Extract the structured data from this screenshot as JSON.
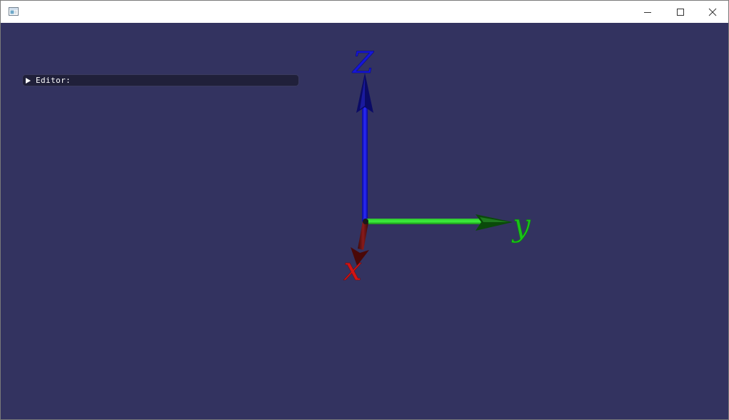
{
  "window": {
    "icon": "app-window-icon",
    "controls": {
      "minimize_icon": "minimize-icon",
      "maximize_icon": "maximize-icon",
      "close_icon": "close-icon"
    }
  },
  "viewport": {
    "background_color": "#333360"
  },
  "editor": {
    "label": "Editor:",
    "icon": "collapse-arrow-icon"
  },
  "axes": {
    "x": {
      "label": "x",
      "color": "#d21414"
    },
    "y": {
      "label": "y",
      "color": "#19c319"
    },
    "z": {
      "label": "Z",
      "color": "#1616d8"
    }
  }
}
